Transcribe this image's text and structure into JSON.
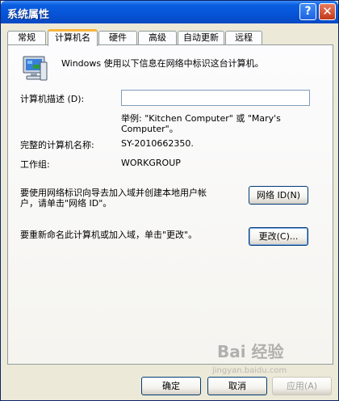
{
  "window": {
    "title": "系统属性"
  },
  "titlebar": {
    "help_glyph": "?",
    "close_glyph": "✕"
  },
  "tabs": [
    {
      "label": "常规"
    },
    {
      "label": "计算机名"
    },
    {
      "label": "硬件"
    },
    {
      "label": "高级"
    },
    {
      "label": "自动更新"
    },
    {
      "label": "远程"
    }
  ],
  "active_tab": "计算机名",
  "computer_name_tab": {
    "intro_text": "Windows 使用以下信息在网络中标识这台计算机。",
    "description_label": "计算机描述 (D):",
    "description_value": "",
    "example_line1": "举例: \"Kitchen Computer\" 或 \"Mary's",
    "example_line2": "Computer\"。",
    "full_name_label": "完整的计算机名称:",
    "full_name_value": "SY-2010662350.",
    "workgroup_label": "工作组:",
    "workgroup_value": "WORKGROUP",
    "network_id_text_line1": "要使用网络标识向导去加入域并创建本地用户帐",
    "network_id_text_line2": "户，请单击\"网络 ID\"。",
    "network_id_button": "网络 ID(N)",
    "rename_text": "要重新命名此计算机或加入域，单击\"更改\"。",
    "change_button": "更改(C)..."
  },
  "footer": {
    "ok_button": "确定",
    "cancel_button": "取消",
    "apply_button": "应用(A)"
  },
  "watermark": {
    "text": "Bai 经验",
    "sub": "jingyan.baidu.com"
  },
  "colors": {
    "titlebar": "#0653d6",
    "dialog_bg": "#ece9d8",
    "active_tab_accent": "#f7b53c",
    "button_border": "#003c74"
  },
  "icons": [
    "computer-icon",
    "help-icon",
    "close-icon"
  ]
}
